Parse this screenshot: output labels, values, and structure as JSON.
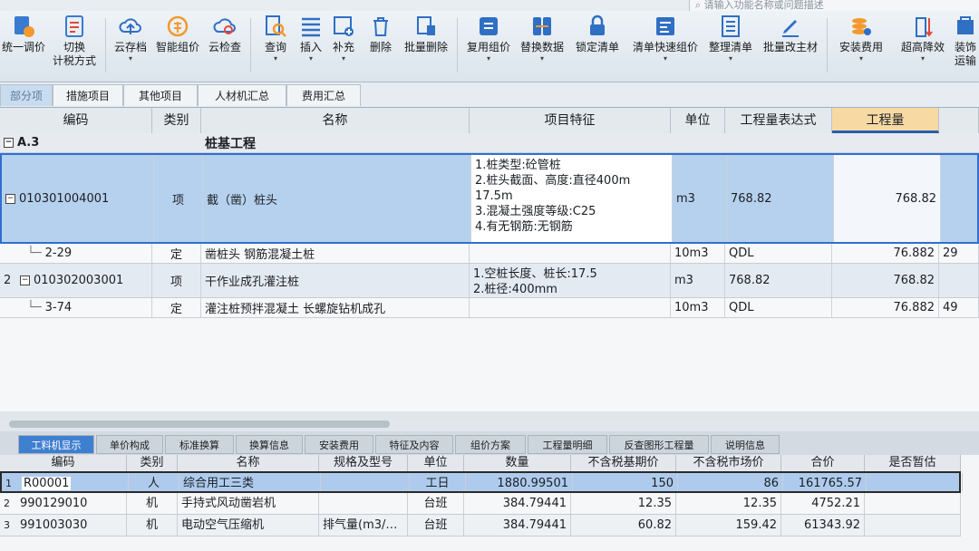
{
  "search": {
    "placeholder": "请输入功能名称或问题描述"
  },
  "toolbar": {
    "items": [
      {
        "label": "统一调价",
        "icon": "adjust-price-icon"
      },
      {
        "label": "切换",
        "label2": "计税方式",
        "icon": "switch-tax-icon"
      },
      {
        "label": "云存档",
        "icon": "cloud-upload-icon"
      },
      {
        "label": "智能组价",
        "icon": "smart-price-icon"
      },
      {
        "label": "云检查",
        "icon": "cloud-check-icon"
      },
      {
        "label": "查询",
        "icon": "query-icon"
      },
      {
        "label": "插入",
        "icon": "insert-icon"
      },
      {
        "label": "补充",
        "icon": "supplement-icon"
      },
      {
        "label": "删除",
        "icon": "delete-icon"
      },
      {
        "label": "批量删除",
        "icon": "batch-delete-icon"
      },
      {
        "label": "复用组价",
        "icon": "reuse-price-icon"
      },
      {
        "label": "替换数据",
        "icon": "replace-data-icon"
      },
      {
        "label": "锁定清单",
        "icon": "lock-icon"
      },
      {
        "label": "清单快速组价",
        "icon": "quick-price-icon"
      },
      {
        "label": "整理清单",
        "icon": "organize-list-icon"
      },
      {
        "label": "批量改主材",
        "icon": "batch-edit-icon"
      },
      {
        "label": "安装费用",
        "icon": "install-fee-icon"
      },
      {
        "label": "超高降效",
        "icon": "height-efficiency-icon"
      },
      {
        "label": "装饰",
        "label2": "运输",
        "icon": "decoration-icon"
      }
    ]
  },
  "tabs": [
    {
      "label": "部分项"
    },
    {
      "label": "措施项目"
    },
    {
      "label": "其他项目"
    },
    {
      "label": "人材机汇总"
    },
    {
      "label": "费用汇总"
    }
  ],
  "grid": {
    "headers": [
      "编码",
      "类别",
      "名称",
      "项目特征",
      "单位",
      "工程量表达式",
      "工程量"
    ],
    "section": {
      "code": "A.3",
      "name": "桩基工程"
    },
    "rows": [
      {
        "num": "",
        "code": "010301004001",
        "type": "项",
        "name": "截（凿）桩头",
        "features": [
          "1.桩类型:砼管桩",
          "2.桩头截面、高度:直径400m",
          "17.5m",
          "3.混凝土强度等级:C25",
          "4.有无钢筋:无钢筋"
        ],
        "unit": "m3",
        "expr": "768.82",
        "qty": "768.82",
        "extra": ""
      },
      {
        "num": "",
        "code": "2-29",
        "type": "定",
        "name": "凿桩头 钢筋混凝土桩",
        "features": [],
        "unit": "10m3",
        "expr": "QDL",
        "qty": "76.882",
        "extra": "29"
      },
      {
        "num": "2",
        "code": "010302003001",
        "type": "项",
        "name": "干作业成孔灌注桩",
        "features": [
          "1.空桩长度、桩长:17.5",
          "2.桩径:400mm"
        ],
        "unit": "m3",
        "expr": "768.82",
        "qty": "768.82",
        "extra": ""
      },
      {
        "num": "",
        "code": "3-74",
        "type": "定",
        "name": "灌注桩预拌混凝土 长螺旋钻机成孔",
        "features": [],
        "unit": "10m3",
        "expr": "QDL",
        "qty": "76.882",
        "extra": "49"
      }
    ]
  },
  "lower_tabs": [
    {
      "label": "工料机显示"
    },
    {
      "label": "单价构成"
    },
    {
      "label": "标准换算"
    },
    {
      "label": "换算信息"
    },
    {
      "label": "安装费用"
    },
    {
      "label": "特征及内容"
    },
    {
      "label": "组价方案"
    },
    {
      "label": "工程量明细"
    },
    {
      "label": "反查图形工程量"
    },
    {
      "label": "说明信息"
    }
  ],
  "lower_grid": {
    "headers": [
      "编码",
      "类别",
      "名称",
      "规格及型号",
      "单位",
      "数量",
      "不含税基期价",
      "不含税市场价",
      "合价",
      "是否暂估"
    ],
    "rows": [
      {
        "num": "1",
        "code": "R00001",
        "type": "人",
        "name": "综合用工三类",
        "spec": "",
        "unit": "工日",
        "qty": "1880.99501",
        "base": "150",
        "market": "86",
        "total": "161765.57"
      },
      {
        "num": "2",
        "code": "990129010",
        "type": "机",
        "name": "手持式风动凿岩机",
        "spec": "",
        "unit": "台班",
        "qty": "384.79441",
        "base": "12.35",
        "market": "12.35",
        "total": "4752.21"
      },
      {
        "num": "3",
        "code": "991003030",
        "type": "机",
        "name": "电动空气压缩机",
        "spec": "排气量(m3/…",
        "unit": "台班",
        "qty": "384.79441",
        "base": "60.82",
        "market": "159.42",
        "total": "61343.92"
      }
    ]
  },
  "colors": {
    "accent": "#3f7fd0",
    "selected_row": "#a9c8ec",
    "active_header": "#f7d9a3"
  }
}
